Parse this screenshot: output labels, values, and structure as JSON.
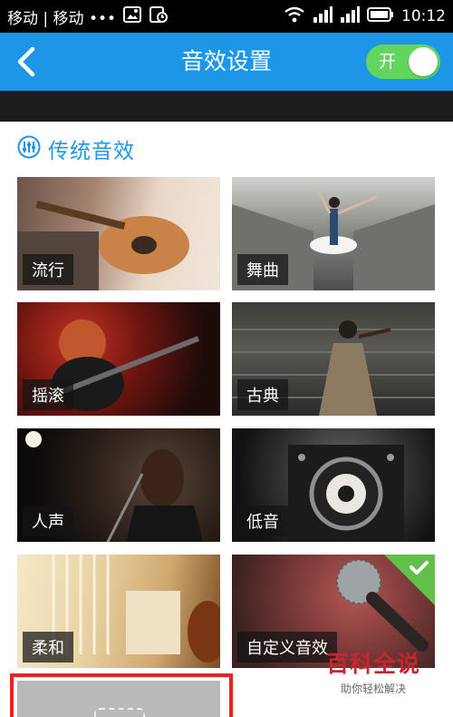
{
  "status_bar": {
    "carrier": "移动 | 移动 •••",
    "time": "10:12",
    "icons": [
      "picture-icon",
      "sync-icon",
      "wifi-icon",
      "signal-icon",
      "signal-icon",
      "battery-icon"
    ]
  },
  "title_bar": {
    "title": "音效设置",
    "back_icon": "chevron-left-icon",
    "toggle": {
      "label": "开",
      "on": true
    }
  },
  "section": {
    "title": "传统音效",
    "icon": "equalizer-icon"
  },
  "presets": [
    {
      "label": "流行",
      "selected": false
    },
    {
      "label": "舞曲",
      "selected": false
    },
    {
      "label": "摇滚",
      "selected": false
    },
    {
      "label": "古典",
      "selected": false
    },
    {
      "label": "人声",
      "selected": false
    },
    {
      "label": "低音",
      "selected": false
    },
    {
      "label": "柔和",
      "selected": false
    },
    {
      "label": "自定义音效",
      "selected": true
    }
  ],
  "watermark": {
    "brand": "百科全说",
    "tagline": "助你轻松解决"
  },
  "colors": {
    "accent": "#1d96e8",
    "toggle_on": "#62d55f",
    "check": "#62c04a",
    "highlight_frame": "#e52424"
  }
}
